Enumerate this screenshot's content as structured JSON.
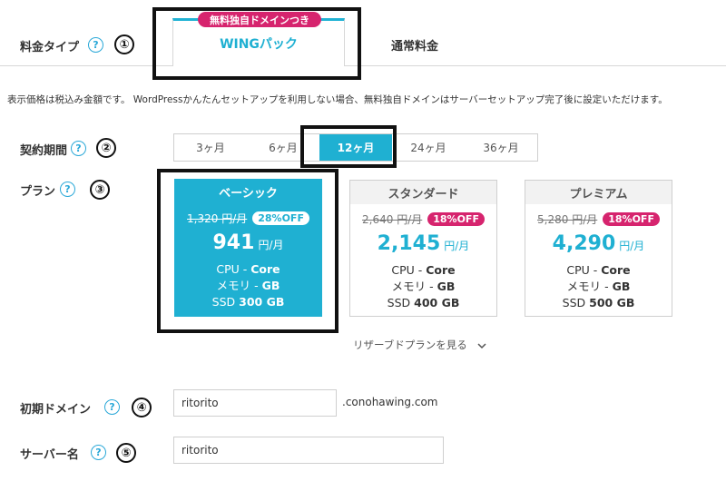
{
  "fee_type": {
    "label": "料金タイプ",
    "help": "?",
    "step": "①",
    "active_tab": {
      "badge": "無料独自ドメインつき",
      "label": "WINGパック"
    },
    "other_tab": "通常料金"
  },
  "note": "表示価格は税込み金額です。 WordPressかんたんセットアップを利用しない場合、無料独自ドメインはサーバーセットアップ完了後に設定いただけます。",
  "period": {
    "label": "契約期間",
    "help": "?",
    "step": "②",
    "options": [
      {
        "label": "3ヶ月"
      },
      {
        "label": "6ヶ月"
      },
      {
        "label": "12ヶ月",
        "selected": true
      },
      {
        "label": "24ヶ月"
      },
      {
        "label": "36ヶ月"
      }
    ]
  },
  "plan": {
    "label": "プラン",
    "help": "?",
    "step": "③",
    "cards": [
      {
        "name": "ベーシック",
        "old_price": "1,320 円/月",
        "discount": "28%OFF",
        "price": "941",
        "unit": "円/月",
        "cpu_label": "CPU",
        "cpu_value": "Core",
        "mem_label": "メモリ",
        "mem_value": "GB",
        "ssd_label": "SSD",
        "ssd_value": "300 GB",
        "selected": true
      },
      {
        "name": "スタンダード",
        "old_price": "2,640 円/月",
        "discount": "18%OFF",
        "price": "2,145",
        "unit": "円/月",
        "cpu_label": "CPU",
        "cpu_value": "Core",
        "mem_label": "メモリ",
        "mem_value": "GB",
        "ssd_label": "SSD",
        "ssd_value": "400 GB"
      },
      {
        "name": "プレミアム",
        "old_price": "5,280 円/月",
        "discount": "18%OFF",
        "price": "4,290",
        "unit": "円/月",
        "cpu_label": "CPU",
        "cpu_value": "Core",
        "mem_label": "メモリ",
        "mem_value": "GB",
        "ssd_label": "SSD",
        "ssd_value": "500 GB"
      }
    ],
    "more_plans": "リザーブドプランを見る"
  },
  "initial_domain": {
    "label": "初期ドメイン",
    "help": "?",
    "step": "④",
    "value": "ritorito",
    "suffix": ".conohawing.com"
  },
  "server_name": {
    "label": "サーバー名",
    "help": "?",
    "step": "⑤",
    "value": "ritorito"
  },
  "colors": {
    "accent": "#1fb0d2",
    "badge": "#d6246e",
    "annotation": "#111111"
  }
}
